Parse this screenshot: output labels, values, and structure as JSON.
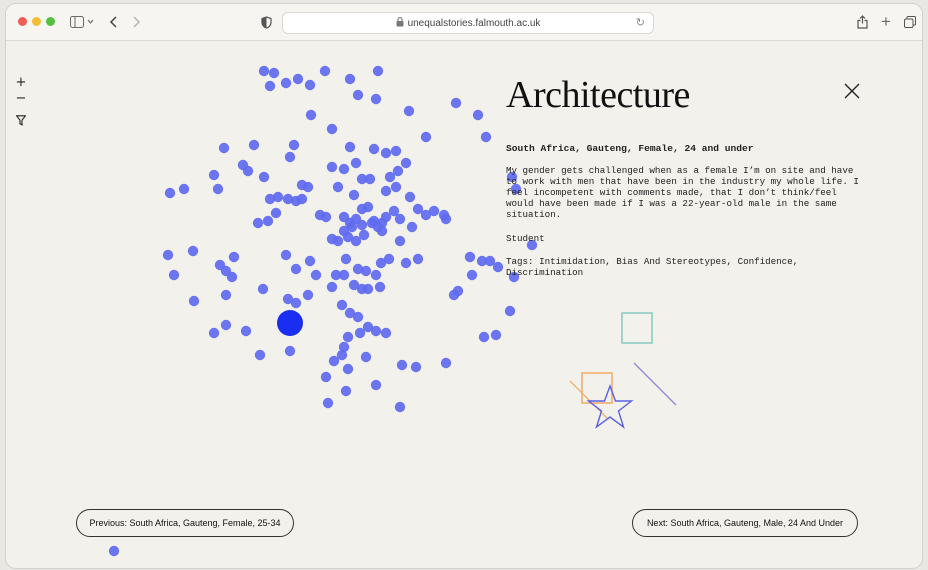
{
  "browser": {
    "url": "unequalstories.falmouth.ac.uk"
  },
  "controls": {
    "zoom_in": "+",
    "zoom_out": "−"
  },
  "story": {
    "title": "Architecture",
    "location": "South Africa, Gauteng, Female, 24 and under",
    "quote": "My gender gets challenged when as a female I’m on site and have to work with men that have been in the industry my whole life. I feel incompetent with comments made, that I don’t think/feel would have been made if I was a 22-year-old male in the same situation.",
    "role": "Student",
    "tags": "Tags: Intimidation, Bias And Stereotypes, Confidence, Discrimination"
  },
  "navigation": {
    "previous_label": "Previous: South Africa, Gauteng, Female, 25-34",
    "next_label": "Next: South Africa, Gauteng, Male, 24 And Under"
  },
  "colors": {
    "dot": "#5f6af0",
    "dot_selected": "#1a2ef2",
    "square_teal": "#7cc7bd",
    "square_orange": "#f2a65a",
    "line_purple": "#9a8bd8",
    "star_blue": "#5860e8"
  }
}
